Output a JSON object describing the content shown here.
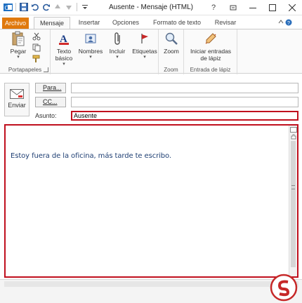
{
  "window": {
    "title": "Ausente - Mensaje (HTML)"
  },
  "tabs": [
    {
      "label": "Archivo"
    },
    {
      "label": "Mensaje"
    },
    {
      "label": "Insertar"
    },
    {
      "label": "Opciones"
    },
    {
      "label": "Formato de texto"
    },
    {
      "label": "Revisar"
    }
  ],
  "ribbon": {
    "clipboard": {
      "paste_label": "Pegar",
      "group_label": "Portapapeles"
    },
    "basic_text": {
      "label_line1": "Texto",
      "label_line2": "básico"
    },
    "names": {
      "label": "Nombres"
    },
    "include": {
      "label": "Incluir"
    },
    "tags": {
      "label": "Etiquetas"
    },
    "zoom": {
      "label": "Zoom",
      "group_label": "Zoom"
    },
    "ink": {
      "label_line1": "Iniciar entradas",
      "label_line2": "de lápiz",
      "group_label": "Entrada de lápiz"
    }
  },
  "header": {
    "send_label": "Enviar",
    "to_label": "Para...",
    "cc_label": "CC...",
    "subject_label": "Asunto:",
    "subject_value": "Ausente",
    "to_value": "",
    "cc_value": ""
  },
  "body": {
    "text": "Estoy fuera de la oficina, más tarde te escribo."
  },
  "colors": {
    "file_tab": "#e0790d",
    "highlight_border": "#c0101e",
    "body_text": "#1f3f73"
  }
}
